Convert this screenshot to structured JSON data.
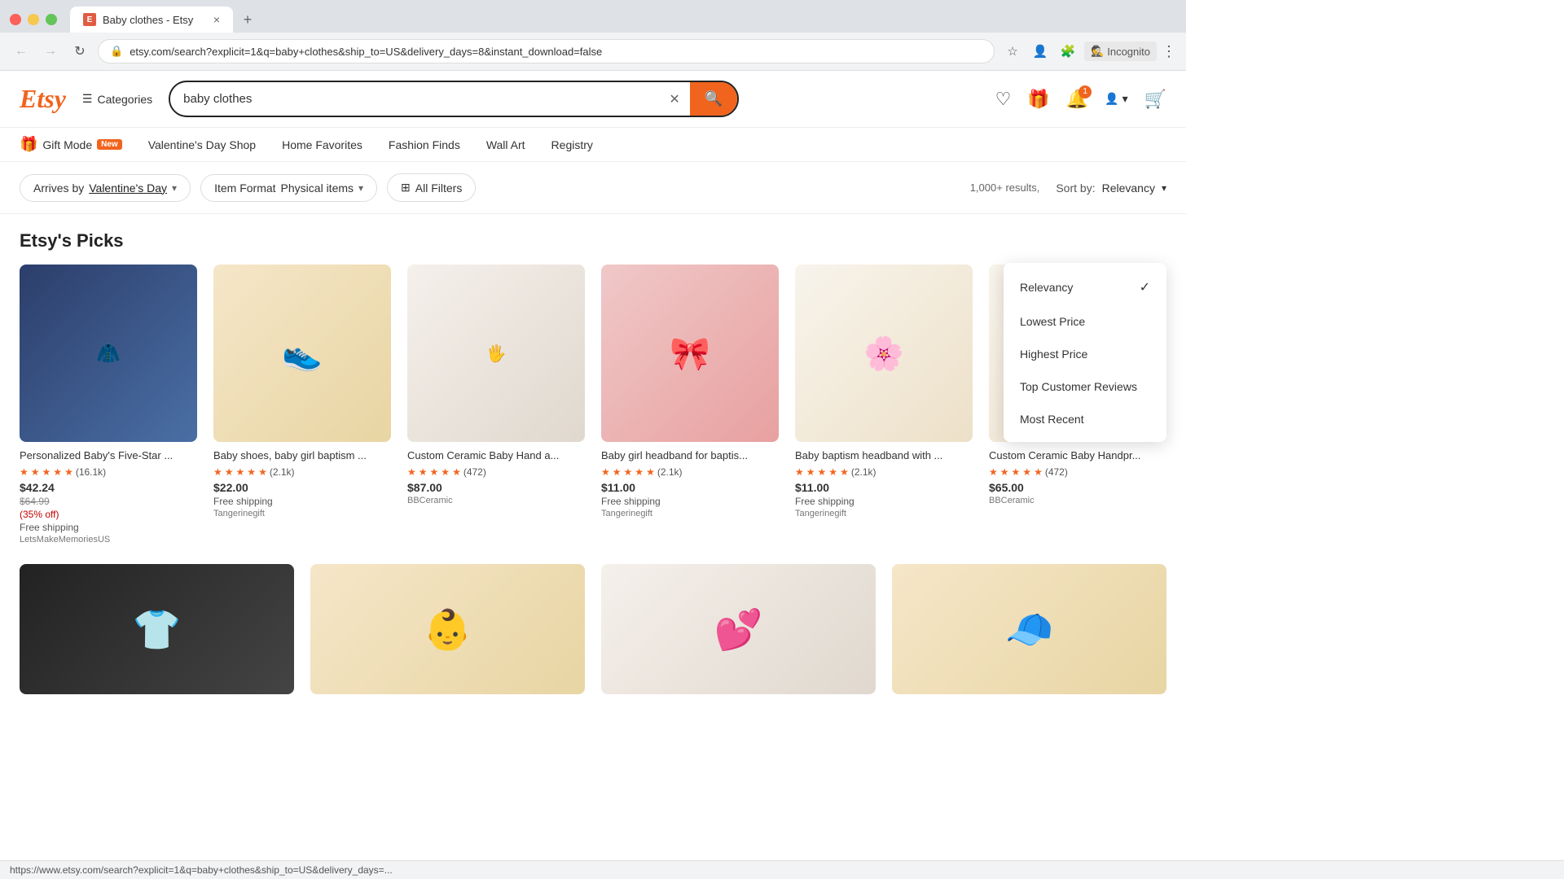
{
  "browser": {
    "tab_title": "Baby clothes - Etsy",
    "favicon_text": "E",
    "address": "etsy.com/search?explicit=1&q=baby+clothes&ship_to=US&delivery_days=8&instant_download=false",
    "new_tab_label": "+",
    "close_tab_label": "×",
    "incognito_label": "Incognito",
    "status_url": "https://www.etsy.com/search?explicit=1&q=baby+clothes&ship_to=US&delivery_days=..."
  },
  "header": {
    "logo": "Etsy",
    "categories_label": "Categories",
    "search_value": "baby clothes",
    "search_placeholder": "baby clothes",
    "nav_items": [
      {
        "id": "gift-mode",
        "label": "Gift Mode",
        "badge": "New",
        "has_gift_icon": true
      },
      {
        "id": "valentines",
        "label": "Valentine's Day Shop"
      },
      {
        "id": "home-favorites",
        "label": "Home Favorites"
      },
      {
        "id": "fashion-finds",
        "label": "Fashion Finds"
      },
      {
        "id": "wall-art",
        "label": "Wall Art"
      },
      {
        "id": "registry",
        "label": "Registry"
      }
    ]
  },
  "filters": {
    "chips": [
      {
        "id": "arrives-by",
        "label": "Arrives by",
        "value": "Valentine's Day",
        "has_arrow": true
      },
      {
        "id": "item-format",
        "label": "Item Format",
        "value": "Physical items",
        "has_arrow": true
      },
      {
        "id": "all-filters",
        "label": "All Filters",
        "has_icon": true
      }
    ],
    "results_text": "1,000+ results,",
    "sort_label": "Sort by:",
    "sort_value": "Relevancy",
    "sort_options": [
      {
        "id": "relevancy",
        "label": "Relevancy",
        "selected": true
      },
      {
        "id": "lowest-price",
        "label": "Lowest Price",
        "selected": false
      },
      {
        "id": "highest-price",
        "label": "Highest Price",
        "selected": false
      },
      {
        "id": "top-reviews",
        "label": "Top Customer Reviews",
        "selected": false
      },
      {
        "id": "most-recent",
        "label": "Most Recent",
        "selected": false
      }
    ]
  },
  "section": {
    "title": "Etsy's Picks"
  },
  "products": [
    {
      "id": "p1",
      "title": "Personalized Baby's Five-Star ...",
      "rating": "4.9",
      "review_count": "(16.1k)",
      "price": "$42.24",
      "original_price": "$64.99",
      "discount": "(35% off)",
      "shipping": "Free shipping",
      "seller": "LetsMakeMemoriesUS",
      "color": "img-blue"
    },
    {
      "id": "p2",
      "title": "Baby shoes, baby girl baptism ...",
      "rating": "5.0",
      "review_count": "(2.1k)",
      "price": "$22.00",
      "shipping": "Free shipping",
      "seller": "Tangerinegift",
      "color": "img-beige"
    },
    {
      "id": "p3",
      "title": "Custom Ceramic Baby Hand a...",
      "rating": "5.0",
      "review_count": "(472)",
      "price": "$87.00",
      "seller": "BBCeramic",
      "color": "img-white"
    },
    {
      "id": "p4",
      "title": "Baby girl headband for baptis...",
      "rating": "5.0",
      "review_count": "(2.1k)",
      "price": "$11.00",
      "shipping": "Free shipping",
      "seller": "Tangerinegift",
      "color": "img-pink"
    },
    {
      "id": "p5",
      "title": "Baby baptism headband with ...",
      "rating": "5.0",
      "review_count": "(2.1k)",
      "price": "$11.00",
      "shipping": "Free shipping",
      "seller": "Tangerinegift",
      "color": "img-cream"
    },
    {
      "id": "p6",
      "title": "Custom Ceramic Baby Handpr...",
      "rating": "5.0",
      "review_count": "(472)",
      "price": "$65.00",
      "seller": "BBCeramic",
      "color": "img-cream"
    }
  ],
  "second_row": [
    {
      "id": "sr1",
      "color": "img-dark",
      "emoji": "👕"
    },
    {
      "id": "sr2",
      "color": "img-beige",
      "emoji": "👶"
    },
    {
      "id": "sr3",
      "color": "img-white",
      "emoji": "💕"
    },
    {
      "id": "sr4",
      "color": "img-beige",
      "emoji": "🧢"
    }
  ]
}
